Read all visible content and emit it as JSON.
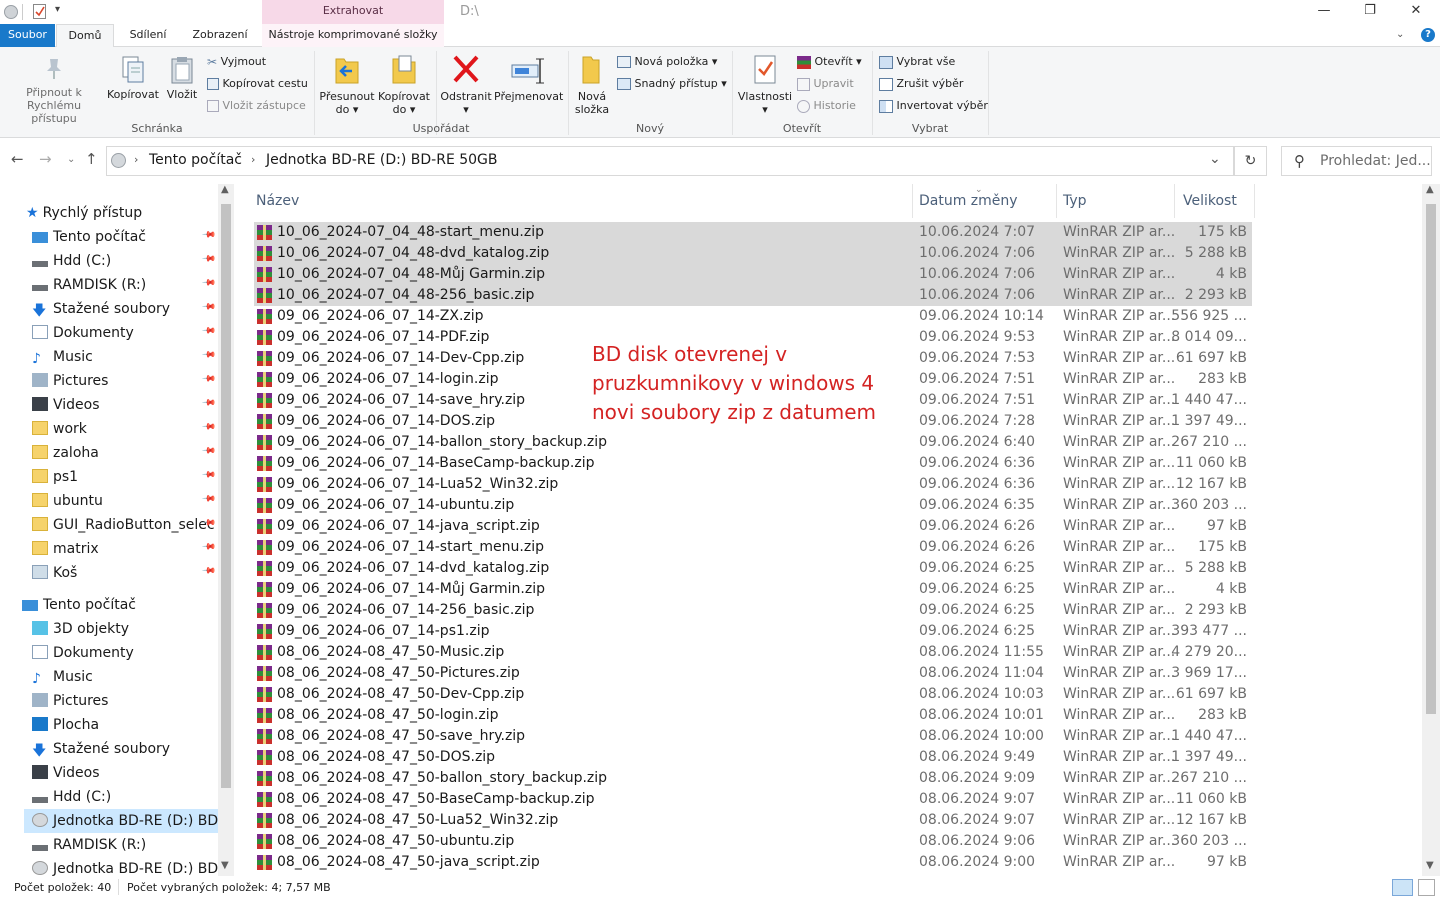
{
  "window": {
    "title": "D:\\",
    "contextual_tab_group": "Extrahovat",
    "minimize": "—",
    "maximize": "❐",
    "close": "✕"
  },
  "tabs": [
    "Soubor",
    "Domů",
    "Sdílení",
    "Zobrazení",
    "Nástroje komprimované složky"
  ],
  "ribbon": {
    "pin": "Připnout k\nRychlému přístupu",
    "copy": "Kopírovat",
    "paste": "Vložit",
    "cut": "Vyjmout",
    "copy_path": "Kopírovat cestu",
    "paste_shortcut": "Vložit zástupce",
    "group_clipboard": "Schránka",
    "move_to": "Přesunout\ndo ▾",
    "copy_to": "Kopírovat\ndo ▾",
    "delete": "Odstranit\n▾",
    "rename": "Přejmenovat",
    "group_organize": "Uspořádat",
    "new_folder": "Nová\nsložka",
    "new_item": "Nová položka ▾",
    "easy_access": "Snadný přístup ▾",
    "group_new": "Nový",
    "properties": "Vlastnosti\n▾",
    "open": "Otevřít ▾",
    "edit": "Upravit",
    "history": "Historie",
    "group_open": "Otevřít",
    "select_all": "Vybrat vše",
    "select_none": "Zrušit výběr",
    "invert_selection": "Invertovat výběr",
    "group_select": "Vybrat"
  },
  "address": {
    "crumbs": [
      "Tento počítač",
      "Jednotka BD-RE (D:) BD-RE 50GB"
    ],
    "search_placeholder": "Prohledat: Jed..."
  },
  "nav": {
    "quick_access": "Rychlý přístup",
    "quick_items": [
      "Tento počítač",
      "Hdd (C:)",
      "RAMDISK (R:)",
      "Stažené soubory",
      "Dokumenty",
      "Music",
      "Pictures",
      "Videos",
      "work",
      "zaloha",
      "ps1",
      "ubuntu",
      "GUI_RadioButton_selec",
      "matrix",
      "Koš"
    ],
    "this_pc": "Tento počítač",
    "pc_items": [
      "3D objekty",
      "Dokumenty",
      "Music",
      "Pictures",
      "Plocha",
      "Stažené soubory",
      "Videos",
      "Hdd (C:)",
      "Jednotka BD-RE (D:) BD-",
      "RAMDISK (R:)",
      "Jednotka BD-RE (D:) BD-R"
    ]
  },
  "columns": {
    "name": "Název",
    "date": "Datum změny",
    "type": "Typ",
    "size": "Velikost"
  },
  "files": [
    {
      "name": "10_06_2024-07_04_48-start_menu.zip",
      "date": "10.06.2024 7:07",
      "type": "WinRAR ZIP ar...",
      "size": "175 kB",
      "selected": true
    },
    {
      "name": "10_06_2024-07_04_48-dvd_katalog.zip",
      "date": "10.06.2024 7:06",
      "type": "WinRAR ZIP ar...",
      "size": "5 288 kB",
      "selected": true
    },
    {
      "name": "10_06_2024-07_04_48-Můj Garmin.zip",
      "date": "10.06.2024 7:06",
      "type": "WinRAR ZIP ar...",
      "size": "4 kB",
      "selected": true
    },
    {
      "name": "10_06_2024-07_04_48-256_basic.zip",
      "date": "10.06.2024 7:06",
      "type": "WinRAR ZIP ar...",
      "size": "2 293 kB",
      "selected": true
    },
    {
      "name": "09_06_2024-06_07_14-ZX.zip",
      "date": "09.06.2024 10:14",
      "type": "WinRAR ZIP ar...",
      "size": "556 925 ...",
      "selected": false
    },
    {
      "name": "09_06_2024-06_07_14-PDF.zip",
      "date": "09.06.2024 9:53",
      "type": "WinRAR ZIP ar...",
      "size": "8 014 09...",
      "selected": false
    },
    {
      "name": "09_06_2024-06_07_14-Dev-Cpp.zip",
      "date": "09.06.2024 7:53",
      "type": "WinRAR ZIP ar...",
      "size": "61 697 kB",
      "selected": false
    },
    {
      "name": "09_06_2024-06_07_14-login.zip",
      "date": "09.06.2024 7:51",
      "type": "WinRAR ZIP ar...",
      "size": "283 kB",
      "selected": false
    },
    {
      "name": "09_06_2024-06_07_14-save_hry.zip",
      "date": "09.06.2024 7:51",
      "type": "WinRAR ZIP ar...",
      "size": "1 440 47...",
      "selected": false
    },
    {
      "name": "09_06_2024-06_07_14-DOS.zip",
      "date": "09.06.2024 7:28",
      "type": "WinRAR ZIP ar...",
      "size": "1 397 49...",
      "selected": false
    },
    {
      "name": "09_06_2024-06_07_14-ballon_story_backup.zip",
      "date": "09.06.2024 6:40",
      "type": "WinRAR ZIP ar...",
      "size": "267 210 ...",
      "selected": false
    },
    {
      "name": "09_06_2024-06_07_14-BaseCamp-backup.zip",
      "date": "09.06.2024 6:36",
      "type": "WinRAR ZIP ar...",
      "size": "11 060 kB",
      "selected": false
    },
    {
      "name": "09_06_2024-06_07_14-Lua52_Win32.zip",
      "date": "09.06.2024 6:36",
      "type": "WinRAR ZIP ar...",
      "size": "12 167 kB",
      "selected": false
    },
    {
      "name": "09_06_2024-06_07_14-ubuntu.zip",
      "date": "09.06.2024 6:35",
      "type": "WinRAR ZIP ar...",
      "size": "360 203 ...",
      "selected": false
    },
    {
      "name": "09_06_2024-06_07_14-java_script.zip",
      "date": "09.06.2024 6:26",
      "type": "WinRAR ZIP ar...",
      "size": "97 kB",
      "selected": false
    },
    {
      "name": "09_06_2024-06_07_14-start_menu.zip",
      "date": "09.06.2024 6:26",
      "type": "WinRAR ZIP ar...",
      "size": "175 kB",
      "selected": false
    },
    {
      "name": "09_06_2024-06_07_14-dvd_katalog.zip",
      "date": "09.06.2024 6:25",
      "type": "WinRAR ZIP ar...",
      "size": "5 288 kB",
      "selected": false
    },
    {
      "name": "09_06_2024-06_07_14-Můj Garmin.zip",
      "date": "09.06.2024 6:25",
      "type": "WinRAR ZIP ar...",
      "size": "4 kB",
      "selected": false
    },
    {
      "name": "09_06_2024-06_07_14-256_basic.zip",
      "date": "09.06.2024 6:25",
      "type": "WinRAR ZIP ar...",
      "size": "2 293 kB",
      "selected": false
    },
    {
      "name": "09_06_2024-06_07_14-ps1.zip",
      "date": "09.06.2024 6:25",
      "type": "WinRAR ZIP ar...",
      "size": "393 477 ...",
      "selected": false
    },
    {
      "name": "08_06_2024-08_47_50-Music.zip",
      "date": "08.06.2024 11:55",
      "type": "WinRAR ZIP ar...",
      "size": "4 279 20...",
      "selected": false
    },
    {
      "name": "08_06_2024-08_47_50-Pictures.zip",
      "date": "08.06.2024 11:04",
      "type": "WinRAR ZIP ar...",
      "size": "3 969 17...",
      "selected": false
    },
    {
      "name": "08_06_2024-08_47_50-Dev-Cpp.zip",
      "date": "08.06.2024 10:03",
      "type": "WinRAR ZIP ar...",
      "size": "61 697 kB",
      "selected": false
    },
    {
      "name": "08_06_2024-08_47_50-login.zip",
      "date": "08.06.2024 10:01",
      "type": "WinRAR ZIP ar...",
      "size": "283 kB",
      "selected": false
    },
    {
      "name": "08_06_2024-08_47_50-save_hry.zip",
      "date": "08.06.2024 10:00",
      "type": "WinRAR ZIP ar...",
      "size": "1 440 47...",
      "selected": false
    },
    {
      "name": "08_06_2024-08_47_50-DOS.zip",
      "date": "08.06.2024 9:49",
      "type": "WinRAR ZIP ar...",
      "size": "1 397 49...",
      "selected": false
    },
    {
      "name": "08_06_2024-08_47_50-ballon_story_backup.zip",
      "date": "08.06.2024 9:09",
      "type": "WinRAR ZIP ar...",
      "size": "267 210 ...",
      "selected": false
    },
    {
      "name": "08_06_2024-08_47_50-BaseCamp-backup.zip",
      "date": "08.06.2024 9:07",
      "type": "WinRAR ZIP ar...",
      "size": "11 060 kB",
      "selected": false
    },
    {
      "name": "08_06_2024-08_47_50-Lua52_Win32.zip",
      "date": "08.06.2024 9:07",
      "type": "WinRAR ZIP ar...",
      "size": "12 167 kB",
      "selected": false
    },
    {
      "name": "08_06_2024-08_47_50-ubuntu.zip",
      "date": "08.06.2024 9:06",
      "type": "WinRAR ZIP ar...",
      "size": "360 203 ...",
      "selected": false
    },
    {
      "name": "08_06_2024-08_47_50-java_script.zip",
      "date": "08.06.2024 9:00",
      "type": "WinRAR ZIP ar...",
      "size": "97 kB",
      "selected": false
    }
  ],
  "annotation": "BD disk otevrenej v pruzkumnikovy v windows 4 novi soubory zip z datumem",
  "status": {
    "items_count": "Počet položek: 40",
    "selected_count": "Počet vybraných položek: 4; 7,57 MB"
  },
  "colors": {
    "accent": "#1979ca",
    "selection": "#d9d9d9",
    "contextual_tab": "#f7d9e8",
    "annotation": "#d42323"
  }
}
